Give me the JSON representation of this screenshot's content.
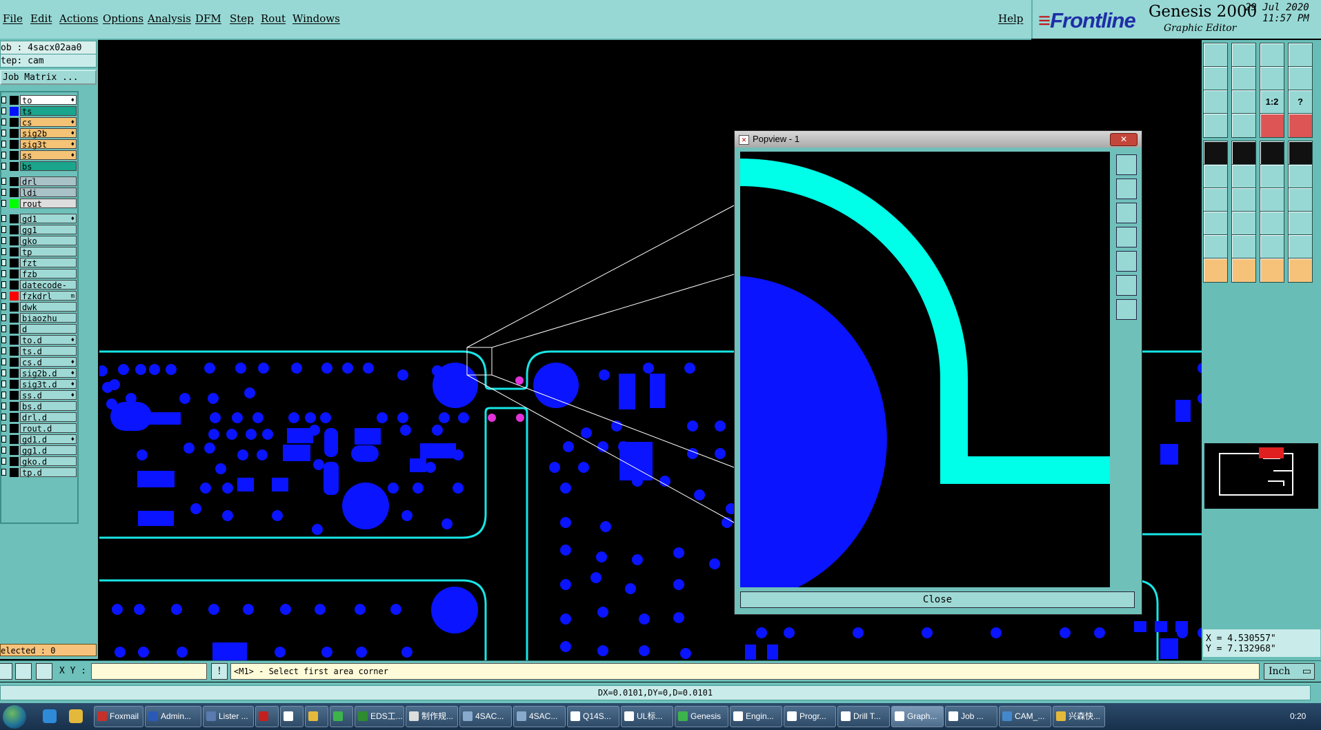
{
  "menu": {
    "items": [
      "File",
      "Edit",
      "Actions",
      "Options",
      "Analysis",
      "DFM",
      "Step",
      "Rout",
      "Windows"
    ],
    "help": "Help"
  },
  "brand": {
    "logo": "Frontline",
    "product": "Genesis 2000",
    "subtitle": "Graphic Editor",
    "date": "29 Jul 2020",
    "time": "11:57 PM"
  },
  "job": {
    "job_label": "ob : 4sacx02aa0",
    "step_label": "tep: cam",
    "matrix_button": "Job Matrix ..."
  },
  "layers": [
    {
      "name": "to",
      "bg": "#ffffff",
      "swatch": "#000000",
      "mark": "♦"
    },
    {
      "name": "ts",
      "bg": "#1aa58c",
      "swatch": "#0011ff",
      "mark": ""
    },
    {
      "name": "cs",
      "bg": "#f5c375",
      "swatch": "#000000",
      "mark": "♦"
    },
    {
      "name": "sig2b",
      "bg": "#f5c375",
      "swatch": "#000000",
      "mark": "♦"
    },
    {
      "name": "sig3t",
      "bg": "#f5c375",
      "swatch": "#000000",
      "mark": "♦"
    },
    {
      "name": "ss",
      "bg": "#f5c375",
      "swatch": "#000000",
      "mark": "♦"
    },
    {
      "name": "bs",
      "bg": "#1aa58c",
      "swatch": "#000000",
      "mark": ""
    },
    {
      "name": "drl",
      "bg": "#a9c2c8",
      "swatch": "#000000",
      "mark": ""
    },
    {
      "name": "ldi",
      "bg": "#a9c2c8",
      "swatch": "#000000",
      "mark": ""
    },
    {
      "name": "rout",
      "bg": "#dddddd",
      "swatch": "#00ff00",
      "mark": ""
    },
    {
      "name": "gd1",
      "bg": "#9fd9d5",
      "swatch": "#000000",
      "mark": "♦"
    },
    {
      "name": "gg1",
      "bg": "#9fd9d5",
      "swatch": "#000000",
      "mark": ""
    },
    {
      "name": "gko",
      "bg": "#9fd9d5",
      "swatch": "#000000",
      "mark": ""
    },
    {
      "name": "tp",
      "bg": "#9fd9d5",
      "swatch": "#000000",
      "mark": ""
    },
    {
      "name": "fzt",
      "bg": "#9fd9d5",
      "swatch": "#000000",
      "mark": ""
    },
    {
      "name": "fzb",
      "bg": "#9fd9d5",
      "swatch": "#000000",
      "mark": ""
    },
    {
      "name": "datecode-to",
      "bg": "#9fd9d5",
      "swatch": "#000000",
      "mark": ""
    },
    {
      "name": "fzkdrl",
      "bg": "#9fd9d5",
      "swatch": "#ff0000",
      "mark": "m"
    },
    {
      "name": "dwk",
      "bg": "#9fd9d5",
      "swatch": "#000000",
      "mark": ""
    },
    {
      "name": "biaozhu",
      "bg": "#9fd9d5",
      "swatch": "#000000",
      "mark": ""
    },
    {
      "name": "d",
      "bg": "#9fd9d5",
      "swatch": "#000000",
      "mark": ""
    },
    {
      "name": "to.d",
      "bg": "#9fd9d5",
      "swatch": "#000000",
      "mark": "♦"
    },
    {
      "name": "ts.d",
      "bg": "#9fd9d5",
      "swatch": "#000000",
      "mark": ""
    },
    {
      "name": "cs.d",
      "bg": "#9fd9d5",
      "swatch": "#000000",
      "mark": "♦"
    },
    {
      "name": "sig2b.d",
      "bg": "#9fd9d5",
      "swatch": "#000000",
      "mark": "♦"
    },
    {
      "name": "sig3t.d",
      "bg": "#9fd9d5",
      "swatch": "#000000",
      "mark": "♦"
    },
    {
      "name": "ss.d",
      "bg": "#9fd9d5",
      "swatch": "#000000",
      "mark": "♦"
    },
    {
      "name": "bs.d",
      "bg": "#9fd9d5",
      "swatch": "#000000",
      "mark": ""
    },
    {
      "name": "drl.d",
      "bg": "#9fd9d5",
      "swatch": "#000000",
      "mark": ""
    },
    {
      "name": "rout.d",
      "bg": "#9fd9d5",
      "swatch": "#000000",
      "mark": ""
    },
    {
      "name": "gd1.d",
      "bg": "#9fd9d5",
      "swatch": "#000000",
      "mark": "♦"
    },
    {
      "name": "gg1.d",
      "bg": "#9fd9d5",
      "swatch": "#000000",
      "mark": ""
    },
    {
      "name": "gko.d",
      "bg": "#9fd9d5",
      "swatch": "#000000",
      "mark": ""
    },
    {
      "name": "tp.d",
      "bg": "#9fd9d5",
      "swatch": "#000000",
      "mark": ""
    }
  ],
  "selected_label": "elected : 0",
  "popview": {
    "title": "Popview - 1",
    "close_button": "Close"
  },
  "coords": {
    "x": "X = 4.530557\"",
    "y": "Y = 7.132968\""
  },
  "command": {
    "xy_label": "X Y :",
    "xy_value": "",
    "prompt": "<M1> - Select first area corner",
    "units": "Inch"
  },
  "measure_text": "DX=0.0101,DY=0,D=0.0101",
  "toolbar_labels": {
    "ratio": "1:2",
    "help": "?"
  },
  "taskbar": {
    "tasks": [
      "Foxmail",
      "Admin...",
      "Lister ...",
      "",
      "",
      "",
      "",
      "EDS工...",
      "制作规...",
      "4SAC...",
      "4SAC...",
      "Q14S...",
      "UL标...",
      "Genesis",
      "Engin...",
      "Progr...",
      "Drill T...",
      "Graph...",
      "Job ...",
      "CAM_...",
      "兴森快..."
    ],
    "clock": "0:20"
  },
  "colors": {
    "teal_ui": "#97d8d4",
    "copper": "#0a14ff",
    "outline": "#18e6e6",
    "popview_trace": "#00ffe8",
    "pad_highlight": "#e033d8"
  }
}
